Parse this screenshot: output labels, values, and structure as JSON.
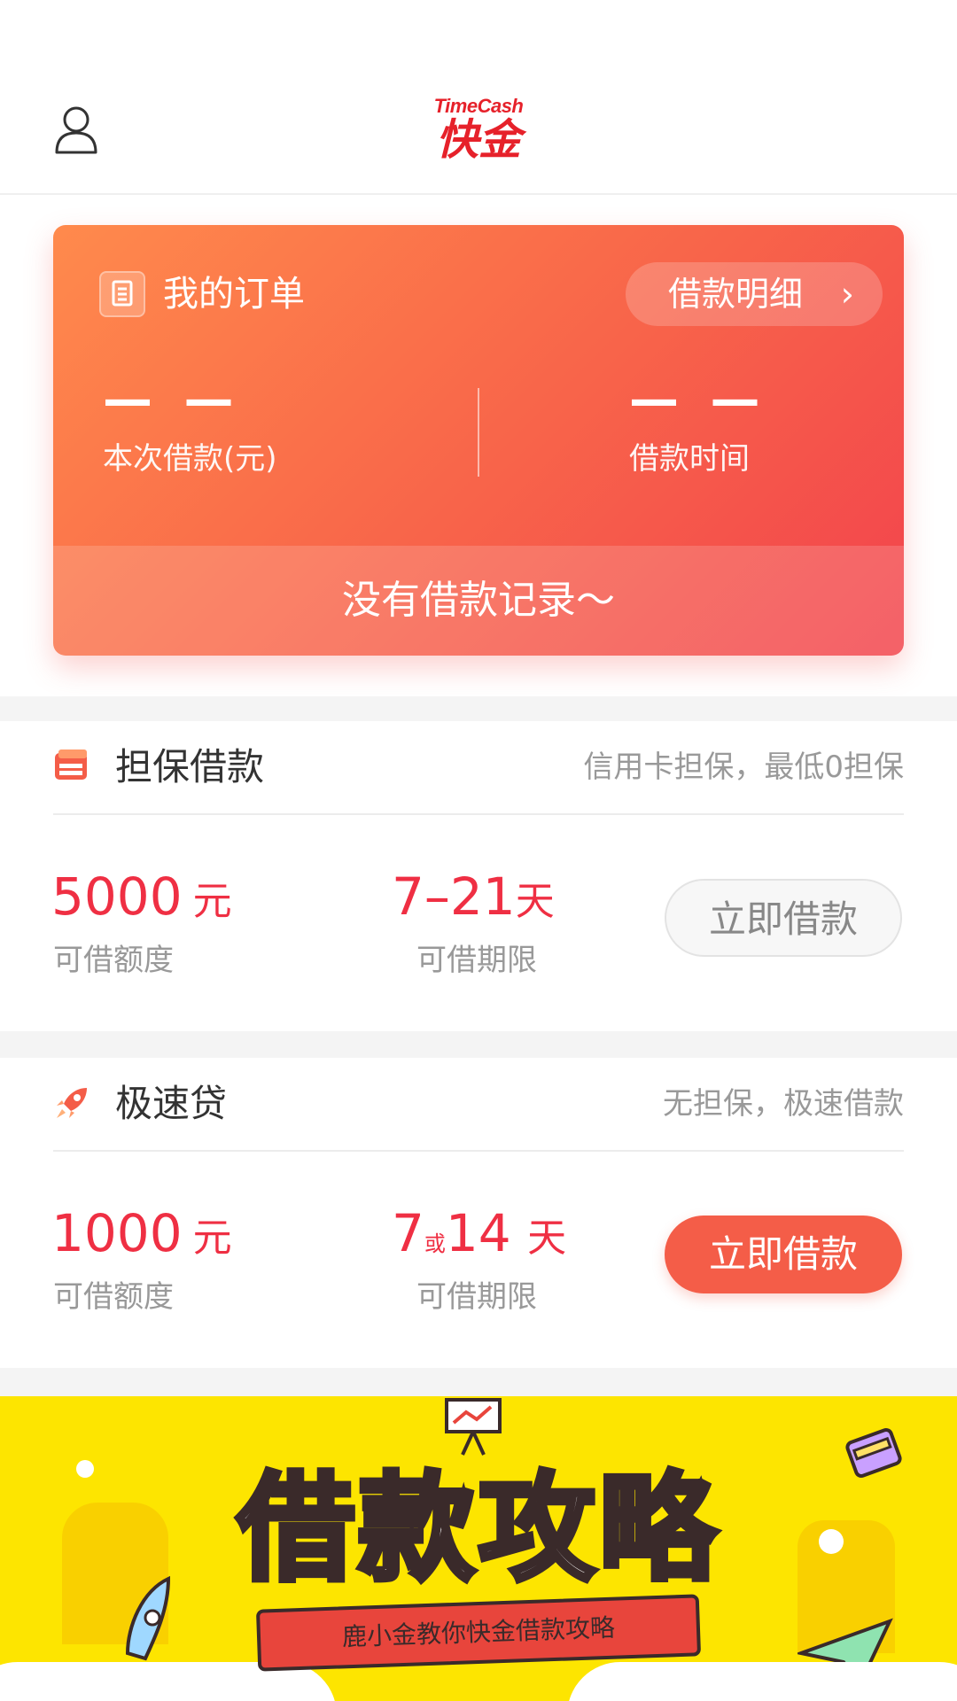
{
  "header": {
    "logo_en": "TimeCash",
    "logo_cn": "快金",
    "user_icon": "user-icon"
  },
  "order_card": {
    "icon": "clipboard-icon",
    "title": "我的订单",
    "detail_button": "借款明细",
    "amount_value": "— —",
    "amount_label": "本次借款(元)",
    "time_value": "— —",
    "time_label": "借款时间",
    "empty_message": "没有借款记录～",
    "colors": {
      "start": "#ff8a4c",
      "end": "#f2434c"
    }
  },
  "products": [
    {
      "icon": "credit-card-icon",
      "title": "担保借款",
      "tagline": "信用卡担保，最低0担保",
      "amount": "5000",
      "amount_unit": "元",
      "amount_label": "可借额度",
      "term": "7–21",
      "term_unit": "天",
      "term_label": "可借期限",
      "button": "立即借款",
      "button_state": "disabled"
    },
    {
      "icon": "rocket-icon",
      "title": "极速贷",
      "tagline": "无担保，极速借款",
      "amount": "1000",
      "amount_unit": "元",
      "amount_label": "可借额度",
      "term_a": "7",
      "term_or": "或",
      "term_b": "14",
      "term_unit": "天",
      "term_label": "可借期限",
      "button": "立即借款",
      "button_state": "active"
    }
  ],
  "banner": {
    "title": "借款攻略",
    "subtitle": "鹿小金教你快金借款攻略"
  },
  "colors": {
    "brand_red": "#e6212a",
    "value_red": "#ef2f43",
    "button_active": "#f45d48",
    "banner_yellow": "#fde500"
  }
}
